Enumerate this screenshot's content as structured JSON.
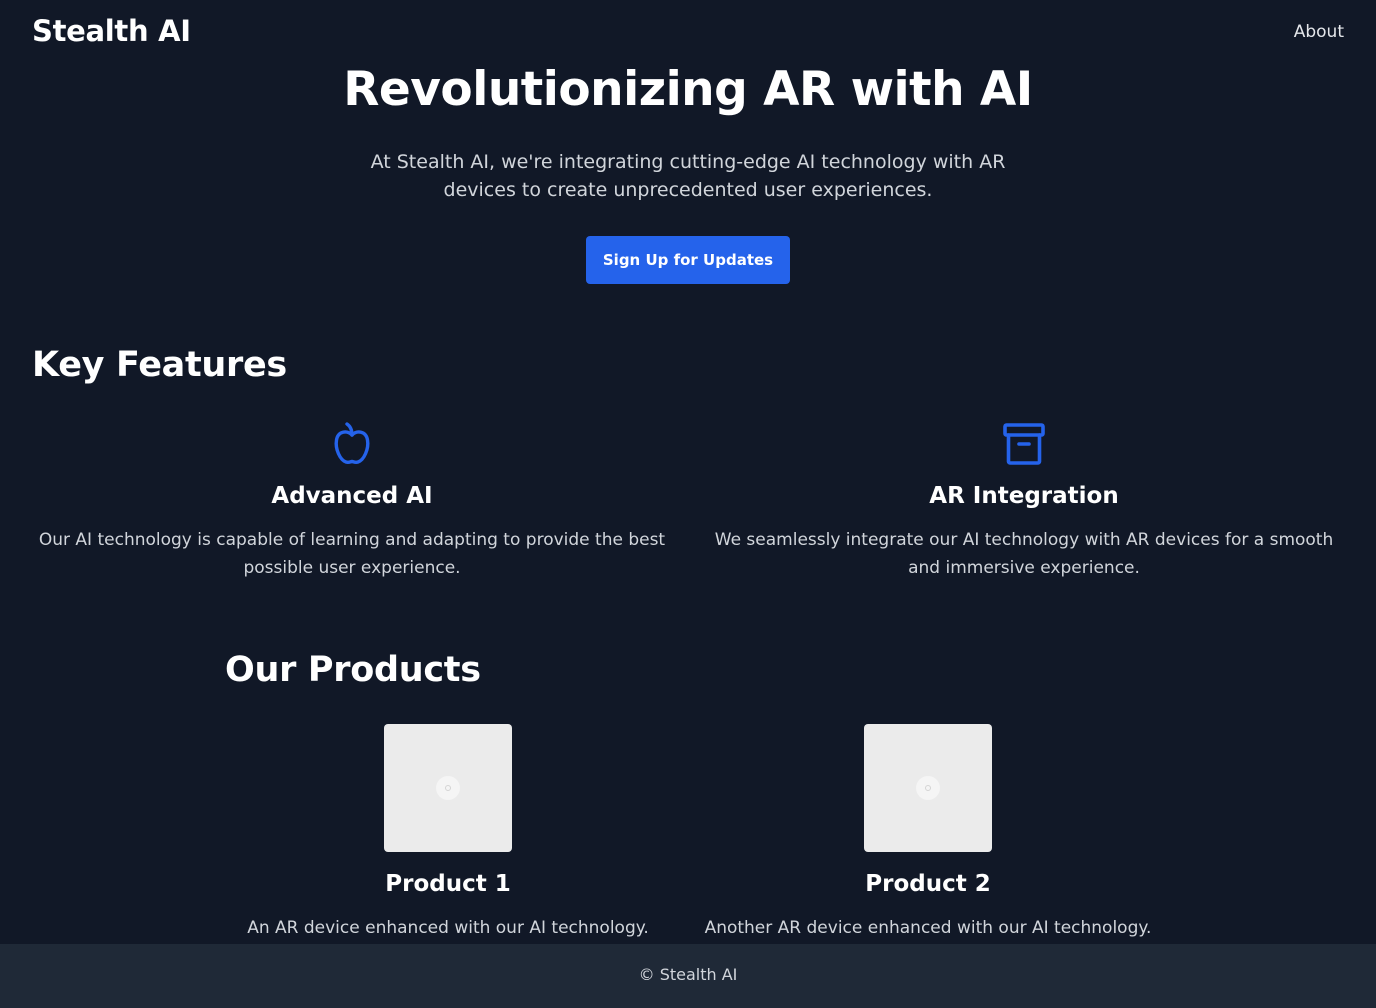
{
  "header": {
    "brand": "Stealth AI",
    "nav_about": "About"
  },
  "hero": {
    "title": "Revolutionizing AR with AI",
    "subtitle": "At Stealth AI, we're integrating cutting-edge AI technology with AR devices to create unprecedented user experiences.",
    "cta_label": "Sign Up for Updates"
  },
  "features": {
    "heading": "Key Features",
    "items": [
      {
        "icon": "apple-icon",
        "title": "Advanced AI",
        "description": "Our AI technology is capable of learning and adapting to provide the best possible user experience."
      },
      {
        "icon": "archive-box-icon",
        "title": "AR Integration",
        "description": "We seamlessly integrate our AI technology with AR devices for a smooth and immersive experience."
      }
    ]
  },
  "products": {
    "heading": "Our Products",
    "items": [
      {
        "title": "Product 1",
        "description": "An AR device enhanced with our AI technology."
      },
      {
        "title": "Product 2",
        "description": "Another AR device enhanced with our AI technology."
      }
    ]
  },
  "footer": {
    "copyright": "© Stealth AI"
  },
  "colors": {
    "background": "#111827",
    "footer_background": "#1f2937",
    "accent": "#2563eb"
  }
}
